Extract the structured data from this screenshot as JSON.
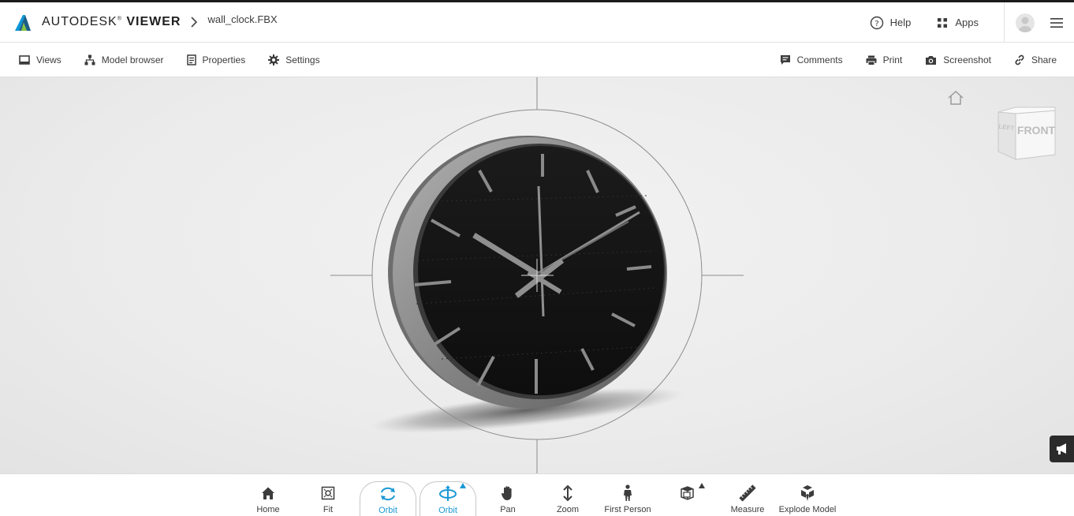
{
  "app": {
    "brand_prefix": "AUTODESK",
    "brand_product": "VIEWER",
    "file_name": "wall_clock.FBX"
  },
  "header": {
    "help_label": "Help",
    "apps_label": "Apps"
  },
  "toolbar": {
    "left": [
      {
        "label": "Views",
        "icon": "views-icon"
      },
      {
        "label": "Model browser",
        "icon": "model-browser-icon"
      },
      {
        "label": "Properties",
        "icon": "properties-icon"
      },
      {
        "label": "Settings",
        "icon": "gear-icon"
      }
    ],
    "right": [
      {
        "label": "Comments",
        "icon": "comment-icon"
      },
      {
        "label": "Print",
        "icon": "printer-icon"
      },
      {
        "label": "Screenshot",
        "icon": "camera-icon"
      },
      {
        "label": "Share",
        "icon": "link-icon"
      }
    ]
  },
  "viewcube": {
    "front_label": "FRONT",
    "left_label": "LEFT"
  },
  "bottom_toolbar": [
    {
      "label": "Home",
      "icon": "home-icon",
      "active": false
    },
    {
      "label": "Fit",
      "icon": "fit-icon",
      "active": false
    },
    {
      "label": "Orbit",
      "icon": "orbit-icon",
      "active": true
    },
    {
      "label": "Orbit",
      "icon": "free-orbit-icon",
      "active": true
    },
    {
      "label": "Pan",
      "icon": "hand-icon",
      "active": false
    },
    {
      "label": "Zoom",
      "icon": "zoom-arrows-icon",
      "active": false
    },
    {
      "label": "First Person",
      "icon": "person-icon",
      "active": false
    },
    {
      "label": "",
      "icon": "camera-views-icon",
      "active": false
    },
    {
      "label": "Measure",
      "icon": "ruler-icon",
      "active": false
    },
    {
      "label": "Explode Model",
      "icon": "explode-icon",
      "active": false
    }
  ],
  "colors": {
    "accent": "#1a98d5",
    "clock_face": "#141414",
    "clock_rim": "#8a8a8a"
  }
}
